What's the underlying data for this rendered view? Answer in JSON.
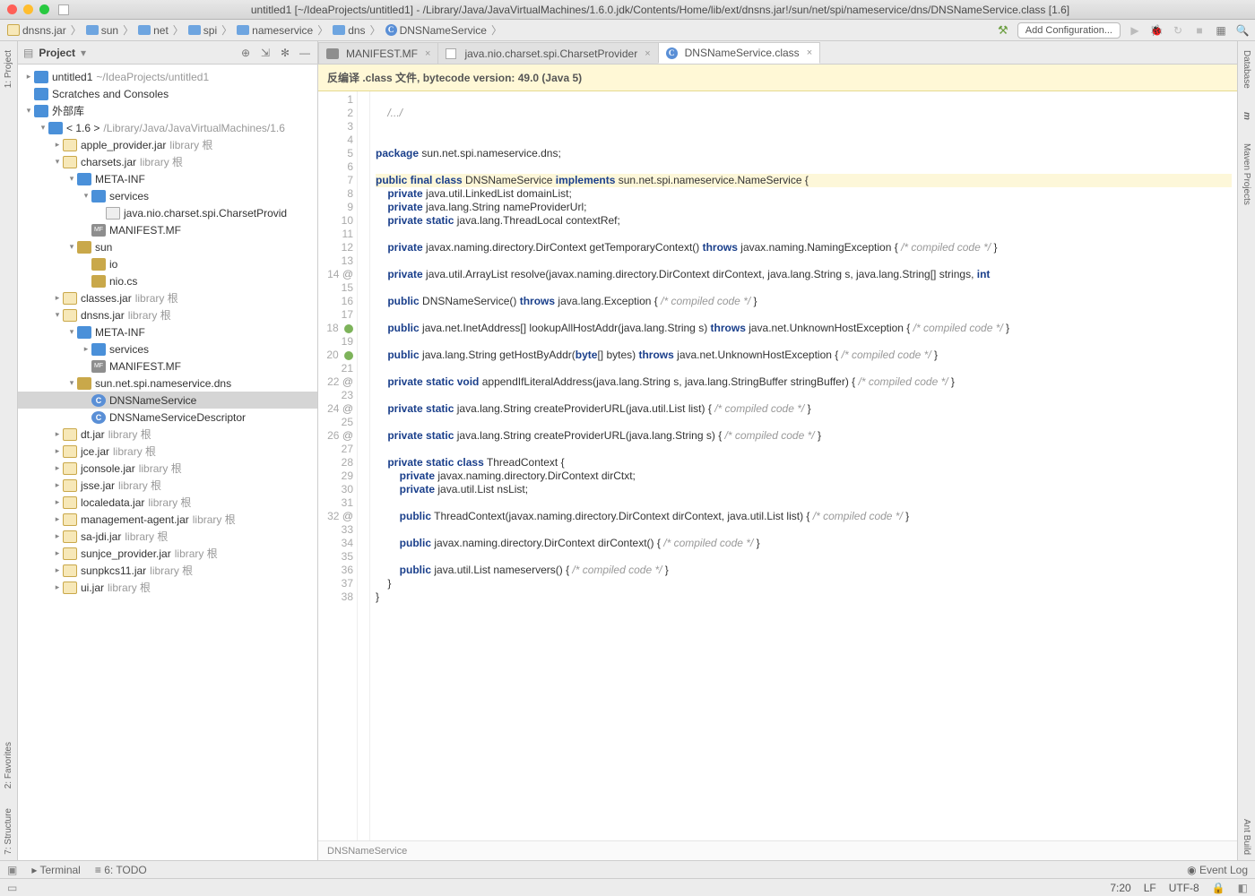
{
  "title": "untitled1 [~/IdeaProjects/untitled1] - /Library/Java/JavaVirtualMachines/1.6.0.jdk/Contents/Home/lib/ext/dnsns.jar!/sun/net/spi/nameservice/dns/DNSNameService.class [1.6]",
  "breadcrumbs": [
    "dnsns.jar",
    "sun",
    "net",
    "spi",
    "nameservice",
    "dns",
    "DNSNameService"
  ],
  "toolbar": {
    "add_config": "Add Configuration..."
  },
  "project": {
    "title": "Project",
    "root": {
      "name": "untitled1",
      "path": "~/IdeaProjects/untitled1"
    },
    "scratches": "Scratches and Consoles",
    "ext_libs": "外部库",
    "jdk": {
      "label": "< 1.6 >",
      "path": "/Library/Java/JavaVirtualMachines/1.6"
    },
    "lib_suffix": "library 根",
    "jars": [
      {
        "name": "apple_provider.jar",
        "open": false
      },
      {
        "name": "charsets.jar",
        "open": true,
        "children": [
          {
            "name": "META-INF",
            "open": true,
            "children": [
              {
                "name": "services",
                "open": true,
                "children": [
                  {
                    "name": "java.nio.charset.spi.CharsetProvid",
                    "type": "file"
                  }
                ]
              },
              {
                "name": "MANIFEST.MF",
                "type": "mf"
              }
            ]
          },
          {
            "name": "sun",
            "type": "pkg",
            "open": true,
            "children": [
              {
                "name": "io",
                "type": "pkg"
              },
              {
                "name": "nio.cs",
                "type": "pkg"
              }
            ]
          }
        ]
      },
      {
        "name": "classes.jar",
        "open": false
      },
      {
        "name": "dnsns.jar",
        "open": true,
        "children": [
          {
            "name": "META-INF",
            "open": true,
            "children": [
              {
                "name": "services",
                "type": "folder"
              },
              {
                "name": "MANIFEST.MF",
                "type": "mf"
              }
            ]
          },
          {
            "name": "sun.net.spi.nameservice.dns",
            "type": "pkg",
            "open": true,
            "children": [
              {
                "name": "DNSNameService",
                "type": "cls",
                "selected": true
              },
              {
                "name": "DNSNameServiceDescriptor",
                "type": "cls"
              }
            ]
          }
        ]
      },
      {
        "name": "dt.jar",
        "open": false
      },
      {
        "name": "jce.jar",
        "open": false
      },
      {
        "name": "jconsole.jar",
        "open": false
      },
      {
        "name": "jsse.jar",
        "open": false
      },
      {
        "name": "localedata.jar",
        "open": false
      },
      {
        "name": "management-agent.jar",
        "open": false
      },
      {
        "name": "sa-jdi.jar",
        "open": false
      },
      {
        "name": "sunjce_provider.jar",
        "open": false
      },
      {
        "name": "sunpkcs11.jar",
        "open": false
      },
      {
        "name": "ui.jar",
        "open": false
      }
    ]
  },
  "tabs": [
    {
      "label": "MANIFEST.MF",
      "icon": "mf"
    },
    {
      "label": "java.nio.charset.spi.CharsetProvider",
      "icon": "file"
    },
    {
      "label": "DNSNameService.class",
      "icon": "cls",
      "active": true
    }
  ],
  "banner": "反编译 .class 文件, bytecode version: 49.0 (Java 5)",
  "code": {
    "lines": [
      {
        "n": 1,
        "t": ""
      },
      {
        "n": 2,
        "t": "/.../",
        "cls": "cm",
        "indent": 1
      },
      {
        "n": 3,
        "t": ""
      },
      {
        "n": 4,
        "t": ""
      },
      {
        "n": 5,
        "html": "<span class='kw'>package</span> sun.net.spi.nameservice.dns;"
      },
      {
        "n": 6,
        "t": ""
      },
      {
        "n": 7,
        "html": "<span class='kw'>public final class</span> DNSNameService <span class='kw'>implements</span> sun.net.spi.nameservice.NameService {",
        "hl": true
      },
      {
        "n": 8,
        "html": "    <span class='kw'>private</span> java.util.LinkedList domainList;"
      },
      {
        "n": 9,
        "html": "    <span class='kw'>private</span> java.lang.String nameProviderUrl;"
      },
      {
        "n": 10,
        "html": "    <span class='kw'>private static</span> java.lang.ThreadLocal contextRef;"
      },
      {
        "n": 11,
        "t": ""
      },
      {
        "n": 12,
        "html": "    <span class='kw'>private</span> javax.naming.directory.DirContext getTemporaryContext() <span class='kw'>throws</span> javax.naming.NamingException { <span class='cm'>/* compiled code */</span> }"
      },
      {
        "n": 13,
        "t": ""
      },
      {
        "n": 14,
        "html": "    <span class='kw'>private</span> java.util.ArrayList resolve(javax.naming.directory.DirContext dirContext, java.lang.String s, java.lang.String[] strings, <span class='kw'>int</span>",
        "mark": "@"
      },
      {
        "n": 15,
        "t": ""
      },
      {
        "n": 16,
        "html": "    <span class='kw'>public</span> DNSNameService() <span class='kw'>throws</span> java.lang.Exception { <span class='cm'>/* compiled code */</span> }"
      },
      {
        "n": 17,
        "t": ""
      },
      {
        "n": 18,
        "html": "    <span class='kw'>public</span> java.net.InetAddress[] lookupAllHostAddr(java.lang.String s) <span class='kw'>throws</span> java.net.UnknownHostException { <span class='cm'>/* compiled code */</span> }",
        "mark": "green"
      },
      {
        "n": 19,
        "t": ""
      },
      {
        "n": 20,
        "html": "    <span class='kw'>public</span> java.lang.String getHostByAddr(<span class='kw'>byte</span>[] bytes) <span class='kw'>throws</span> java.net.UnknownHostException { <span class='cm'>/* compiled code */</span> }",
        "mark": "green"
      },
      {
        "n": 21,
        "t": ""
      },
      {
        "n": 22,
        "html": "    <span class='kw'>private static void</span> appendIfLiteralAddress(java.lang.String s, java.lang.StringBuffer stringBuffer) { <span class='cm'>/* compiled code */</span> }",
        "mark": "@"
      },
      {
        "n": 23,
        "t": ""
      },
      {
        "n": 24,
        "html": "    <span class='kw'>private static</span> java.lang.String createProviderURL(java.util.List list) { <span class='cm'>/* compiled code */</span> }",
        "mark": "@"
      },
      {
        "n": 25,
        "t": ""
      },
      {
        "n": 26,
        "html": "    <span class='kw'>private static</span> java.lang.String createProviderURL(java.lang.String s) { <span class='cm'>/* compiled code */</span> }",
        "mark": "@"
      },
      {
        "n": 27,
        "t": ""
      },
      {
        "n": 28,
        "html": "    <span class='kw'>private static class</span> ThreadContext {"
      },
      {
        "n": 29,
        "html": "        <span class='kw'>private</span> javax.naming.directory.DirContext dirCtxt;"
      },
      {
        "n": 30,
        "html": "        <span class='kw'>private</span> java.util.List nsList;"
      },
      {
        "n": 31,
        "t": ""
      },
      {
        "n": 32,
        "html": "        <span class='kw'>public</span> ThreadContext(javax.naming.directory.DirContext dirContext, java.util.List list) { <span class='cm'>/* compiled code */</span> }",
        "mark": "@"
      },
      {
        "n": 33,
        "t": ""
      },
      {
        "n": 34,
        "html": "        <span class='kw'>public</span> javax.naming.directory.DirContext dirContext() { <span class='cm'>/* compiled code */</span> }"
      },
      {
        "n": 35,
        "t": ""
      },
      {
        "n": 36,
        "html": "        <span class='kw'>public</span> java.util.List nameservers() { <span class='cm'>/* compiled code */</span> }"
      },
      {
        "n": 37,
        "html": "    }"
      },
      {
        "n": 38,
        "html": "}"
      }
    ]
  },
  "crumb_bottom": "DNSNameService",
  "left_tabs": [
    "1: Project",
    "2: Favorites",
    "7: Structure"
  ],
  "right_tabs": [
    "Database",
    "m",
    "Maven Projects",
    "Ant Build"
  ],
  "bottom_tools": {
    "terminal": "Terminal",
    "todo": "6: TODO",
    "eventlog": "Event Log"
  },
  "status": {
    "pos": "7:20",
    "le": "LF",
    "enc": "UTF-8",
    "lock": "🔒"
  }
}
